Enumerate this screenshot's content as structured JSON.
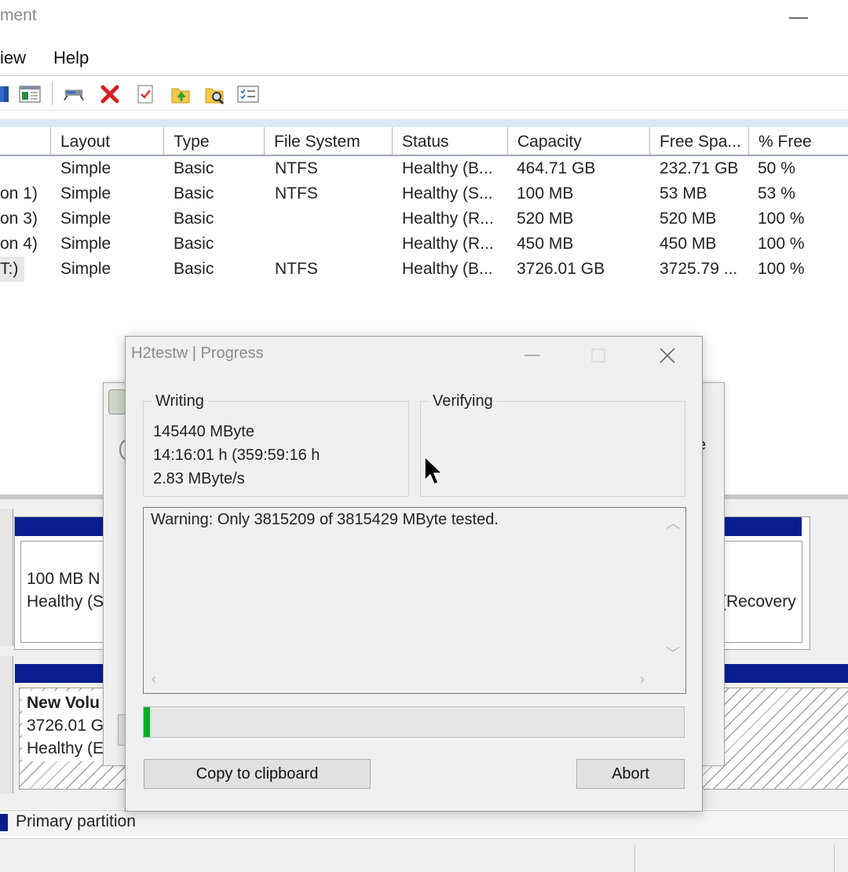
{
  "window": {
    "title_fragment": "ment"
  },
  "menu": {
    "view": "View",
    "view_fragment": "iew",
    "help": "Help"
  },
  "volume_list": {
    "columns": [
      "Layout",
      "Type",
      "File System",
      "Status",
      "Capacity",
      "Free Spa...",
      "% Free"
    ],
    "rows": [
      {
        "name": "",
        "layout": "Simple",
        "type": "Basic",
        "fs": "NTFS",
        "status": "Healthy (B...",
        "capacity": "464.71 GB",
        "free": "232.71 GB",
        "pct": "50 %"
      },
      {
        "name": "on 1)",
        "layout": "Simple",
        "type": "Basic",
        "fs": "NTFS",
        "status": "Healthy (S...",
        "capacity": "100 MB",
        "free": "53 MB",
        "pct": "53 %"
      },
      {
        "name": "on 3)",
        "layout": "Simple",
        "type": "Basic",
        "fs": "",
        "status": "Healthy (R...",
        "capacity": "520 MB",
        "free": "520 MB",
        "pct": "100 %"
      },
      {
        "name": "on 4)",
        "layout": "Simple",
        "type": "Basic",
        "fs": "",
        "status": "Healthy (R...",
        "capacity": "450 MB",
        "free": "450 MB",
        "pct": "100 %"
      },
      {
        "name": "T:)",
        "layout": "Simple",
        "type": "Basic",
        "fs": "NTFS",
        "status": "Healthy (B...",
        "capacity": "3726.01 GB",
        "free": "3725.79 ...",
        "pct": "100 %"
      }
    ]
  },
  "graphical": {
    "disk0_part_size": "100 MB N",
    "disk0_part_status": "Healthy (S",
    "disk0_recovery": "(Recovery",
    "disk1_vol_name": "New Volu",
    "disk1_vol_size": "3726.01 GI",
    "disk1_vol_status": "Healthy (E",
    "bg_dialog_fragment": "e"
  },
  "legend": {
    "primary": "Primary partition"
  },
  "dialog": {
    "title": "H2testw | Progress",
    "writing": {
      "legend": "Writing",
      "amount": "145440 MByte",
      "time": "14:16:01 h (359:59:16 h",
      "rate": "2.83 MByte/s"
    },
    "verifying": {
      "legend": "Verifying"
    },
    "log": "Warning: Only 3815209 of 3815429 MByte tested.",
    "progress_fraction": 0.012,
    "progress_color": "#06b025",
    "copy_button": "Copy to clipboard",
    "abort_button": "Abort"
  },
  "colors": {
    "partition_bar": "#0a1d8f"
  }
}
